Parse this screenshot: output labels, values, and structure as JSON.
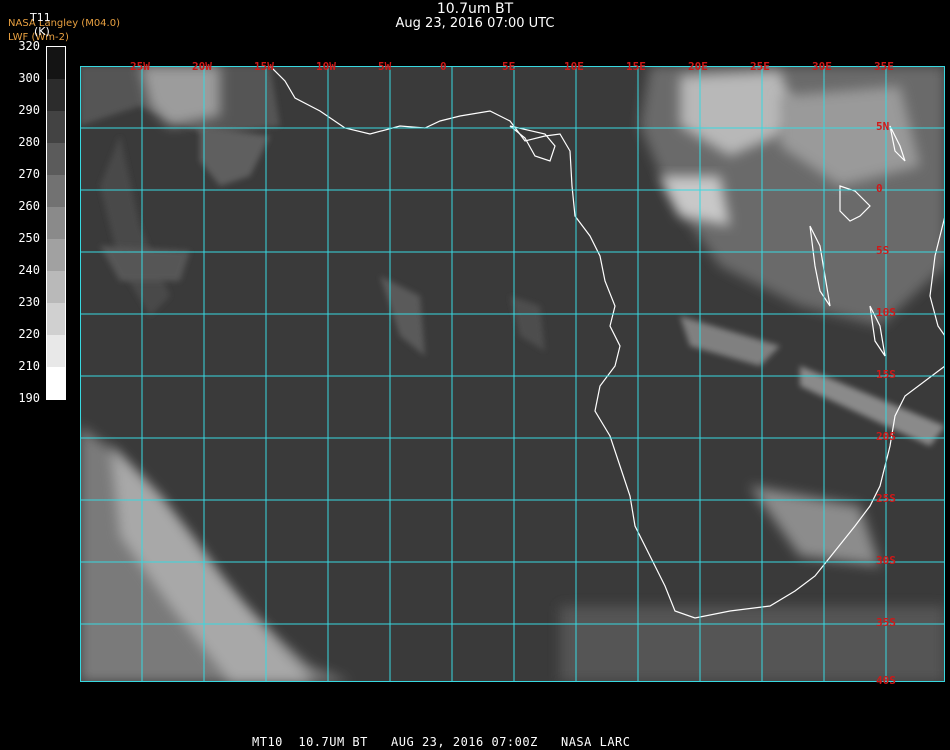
{
  "header": {
    "title": "10.7um BT",
    "subtitle": "Aug 23, 2016 07:00 UTC",
    "overlay_line1": "NASA Langley (M04.0)",
    "overlay_line2": "LWF (Wm-2)"
  },
  "colorbar": {
    "variable": "T11",
    "units": "(K)",
    "ticks": [
      "320",
      "300",
      "290",
      "280",
      "270",
      "260",
      "250",
      "240",
      "230",
      "220",
      "210",
      "190"
    ]
  },
  "map": {
    "lon_labels": [
      "25W",
      "20W",
      "15W",
      "10W",
      "5W",
      "0",
      "5E",
      "10E",
      "15E",
      "20E",
      "25E",
      "30E",
      "35E"
    ],
    "lat_labels": [
      "5N",
      "0",
      "5S",
      "10S",
      "15S",
      "20S",
      "25S",
      "30S",
      "35S",
      "40S"
    ],
    "grid_color": "#38d8e0",
    "coast_color": "#ffffff",
    "label_color": "#d01818"
  },
  "footer": {
    "text": "MT10  10.7UM BT   AUG 23, 2016 07:00Z   NASA LARC"
  }
}
